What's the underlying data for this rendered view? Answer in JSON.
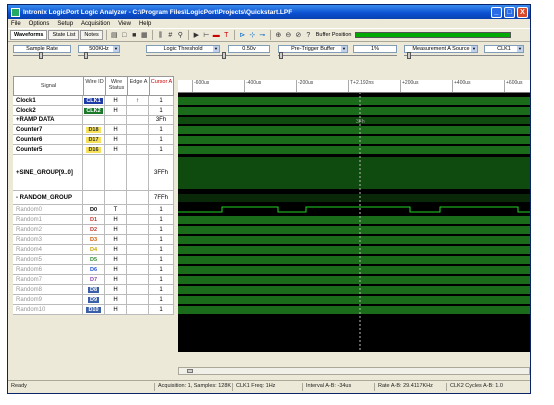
{
  "window": {
    "title": "Intronix LogicPort Logic Analyzer - C:\\Program Files\\LogicPort\\Projects\\Quickstart.LPF",
    "controls": [
      "_",
      "□",
      "X"
    ]
  },
  "menu": [
    "File",
    "Options",
    "Setup",
    "Acquisition",
    "View",
    "Help"
  ],
  "toolbar": {
    "tabs": [
      "Waveforms",
      "State List",
      "Notes"
    ],
    "icons": [
      "open-icon",
      "new-icon",
      "save-icon",
      "print-icon",
      "bars-icon",
      "hash-icon",
      "magnify-icon",
      "run-icon",
      "cursor-icon",
      "stop-icon",
      "trigger-icon",
      "play-icon",
      "step-icon",
      "step2-icon",
      "zoom-in-icon",
      "zoom-out-icon",
      "zoom-fit-icon",
      "help-icon"
    ],
    "buffer_label": "Buffer Position",
    "buffer_fill": 1.0
  },
  "controls": {
    "sample_rate_label": "Sample Rate",
    "sample_rate_value": "500KHz",
    "logic_threshold_label": "Logic Threshold",
    "logic_threshold_value": "0.50v",
    "pretrigger_label": "Pre-Trigger Buffer",
    "pretrigger_value": "1%",
    "measurement_label": "Measurement A Source",
    "measurement_value": "CLK1"
  },
  "columns": [
    "Signal",
    "Wire ID",
    "Wire Status",
    "Edge A",
    "Cursor A"
  ],
  "signals": [
    {
      "name": "Clock1",
      "id": "CLK1",
      "id_bg": "#1e3ba8",
      "id_fg": "#ffffff",
      "status": "H",
      "edge": "↑",
      "cursor": "1",
      "dim": false,
      "h": 10
    },
    {
      "name": "Clock2",
      "id": "CLK2",
      "id_bg": "#1a7a2a",
      "id_fg": "#ffffff",
      "status": "H",
      "edge": "",
      "cursor": "1",
      "dim": false,
      "h": 10
    },
    {
      "name": "+RAMP DATA",
      "id": "",
      "id_bg": "",
      "id_fg": "",
      "status": "",
      "edge": "",
      "cursor": "3Fh",
      "dim": false,
      "h": 9
    },
    {
      "name": "Counter7",
      "id": "D18",
      "id_bg": "#f7e15a",
      "id_fg": "#333333",
      "status": "H",
      "edge": "",
      "cursor": "1",
      "dim": false,
      "h": 10
    },
    {
      "name": "Counter6",
      "id": "D17",
      "id_bg": "#f7e15a",
      "id_fg": "#333333",
      "status": "H",
      "edge": "",
      "cursor": "1",
      "dim": false,
      "h": 10
    },
    {
      "name": "Counter5",
      "id": "D16",
      "id_bg": "#f7e15a",
      "id_fg": "#333333",
      "status": "H",
      "edge": "",
      "cursor": "1",
      "dim": false,
      "h": 10
    },
    {
      "name": "+SINE_GROUP[9..0]",
      "id": "",
      "id_bg": "",
      "id_fg": "",
      "status": "",
      "edge": "",
      "cursor": "3FFh",
      "dim": false,
      "h": 36
    },
    {
      "name": "- RANDOM_GROUP",
      "id": "",
      "id_bg": "",
      "id_fg": "",
      "status": "",
      "edge": "",
      "cursor": "7FFh",
      "dim": false,
      "h": 14
    },
    {
      "name": "Random0",
      "id": "D0",
      "id_bg": "",
      "id_fg": "#000000",
      "status": "T",
      "edge": "",
      "cursor": "1",
      "dim": true,
      "h": 10
    },
    {
      "name": "Random1",
      "id": "D1",
      "id_bg": "",
      "id_fg": "#c0392b",
      "status": "H",
      "edge": "",
      "cursor": "1",
      "dim": true,
      "h": 10
    },
    {
      "name": "Random2",
      "id": "D2",
      "id_bg": "",
      "id_fg": "#c0392b",
      "status": "H",
      "edge": "",
      "cursor": "1",
      "dim": true,
      "h": 10
    },
    {
      "name": "Random3",
      "id": "D3",
      "id_bg": "",
      "id_fg": "#d35400",
      "status": "H",
      "edge": "",
      "cursor": "1",
      "dim": true,
      "h": 10
    },
    {
      "name": "Random4",
      "id": "D4",
      "id_bg": "",
      "id_fg": "#c9a400",
      "status": "H",
      "edge": "",
      "cursor": "1",
      "dim": true,
      "h": 10
    },
    {
      "name": "Random5",
      "id": "D5",
      "id_bg": "",
      "id_fg": "#2e8b2e",
      "status": "H",
      "edge": "",
      "cursor": "1",
      "dim": true,
      "h": 10
    },
    {
      "name": "Random6",
      "id": "D6",
      "id_bg": "",
      "id_fg": "#1f4fd8",
      "status": "H",
      "edge": "",
      "cursor": "1",
      "dim": true,
      "h": 10
    },
    {
      "name": "Random7",
      "id": "D7",
      "id_bg": "",
      "id_fg": "#8e44ad",
      "status": "H",
      "edge": "",
      "cursor": "1",
      "dim": true,
      "h": 10
    },
    {
      "name": "Random8",
      "id": "D8",
      "id_bg": "#3a5ea8",
      "id_fg": "#ffffff",
      "status": "H",
      "edge": "",
      "cursor": "1",
      "dim": true,
      "h": 10
    },
    {
      "name": "Random9",
      "id": "D9",
      "id_bg": "#3a5ea8",
      "id_fg": "#ffffff",
      "status": "H",
      "edge": "",
      "cursor": "1",
      "dim": true,
      "h": 10
    },
    {
      "name": "Random10",
      "id": "D10",
      "id_bg": "#3a5ea8",
      "id_fg": "#ffffff",
      "status": "H",
      "edge": "",
      "cursor": "1",
      "dim": true,
      "h": 10
    }
  ],
  "timescale": [
    "-600us",
    "-400us",
    "-200us",
    "T+2.192ns",
    "+200us",
    "+400us",
    "+600us"
  ],
  "ramp_value": "3Fh",
  "status": {
    "ready": "Ready",
    "acquisition": "Acquisition: 1, Samples: 128K",
    "clk1_freq": "CLK1 Freq: 1Hz",
    "interval": "Interval A-B: -34us",
    "rate": "Rate A-B: 29.4117KHz",
    "cycles": "CLK2 Cycles A-B: 1.0"
  },
  "colors": {
    "wave_green": "#1a6b1a",
    "wave_bright": "#22d322",
    "wave_bg": "#000000"
  }
}
